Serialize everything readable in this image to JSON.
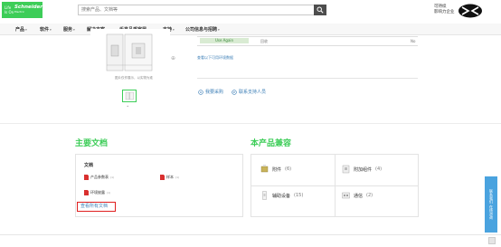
{
  "header": {
    "logo_tagline": "Life Is On",
    "logo_brand": "Schneider",
    "logo_sub": "Electric",
    "search_placeholder": "搜索产品、文档等",
    "sustain_line1": "可持续",
    "sustain_line2": "影响力企业"
  },
  "nav": {
    "items": [
      "产品",
      "软件",
      "服务",
      "解决方案",
      "乐享品质家居",
      "支持",
      "公司信息与招聘"
    ]
  },
  "product": {
    "image_caption": "图片仅作展示，以实物为准",
    "use_again_badge": "Use Again",
    "use_again_mid": "回收",
    "use_again_right": "No",
    "env_link": "查看以下可用环境数据",
    "action_buy": "我要采购",
    "action_contact": "联系支持人员"
  },
  "documents": {
    "heading": "主要文档",
    "card_title": "文档",
    "items": [
      {
        "label": "产品参数表",
        "sub": "(1)"
      },
      {
        "label": "样本",
        "sub": "(1)"
      },
      {
        "label": "环境披露",
        "sub": "(1)"
      }
    ],
    "view_all": "查看所有文档"
  },
  "compat": {
    "heading": "本产品兼容",
    "items": [
      {
        "label": "附件",
        "count": "(6)"
      },
      {
        "label": "附加组件",
        "count": "(4)"
      },
      {
        "label": "辅助设备",
        "count": "(15)"
      },
      {
        "label": "通信",
        "count": "(2)"
      }
    ]
  },
  "side_tab": {
    "line1": "联系我们",
    "line2": "在线咨询"
  },
  "colors": {
    "brand_green": "#3dcd58",
    "link_blue": "#3d7fb7",
    "highlight_red": "#e01f1f",
    "pdf_red": "#d9302f"
  }
}
